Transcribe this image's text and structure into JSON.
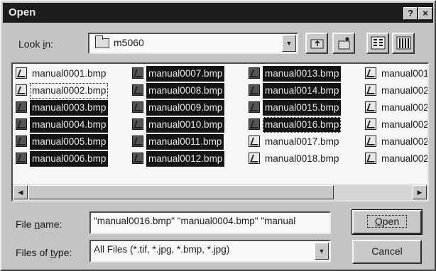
{
  "window": {
    "title": "Open",
    "help_glyph": "?",
    "close_glyph": "×"
  },
  "lookin": {
    "label_prefix": "Look ",
    "label_ul": "i",
    "label_suffix": "n:",
    "value": "m5060"
  },
  "toolbar": {
    "icons": [
      "up-one-level-icon",
      "new-folder-icon",
      "list-view-icon",
      "details-view-icon"
    ]
  },
  "files": {
    "columns": [
      [
        {
          "name": "manual0001.bmp",
          "selected": false
        },
        {
          "name": "manual0002.bmp",
          "selected": false,
          "dotted": true
        },
        {
          "name": "manual0003.bmp",
          "selected": true
        },
        {
          "name": "manual0004.bmp",
          "selected": true
        },
        {
          "name": "manual0005.bmp",
          "selected": true
        },
        {
          "name": "manual0006.bmp",
          "selected": true
        }
      ],
      [
        {
          "name": "manual0007.bmp",
          "selected": true
        },
        {
          "name": "manual0008.bmp",
          "selected": true
        },
        {
          "name": "manual0009.bmp",
          "selected": true
        },
        {
          "name": "manual0010.bmp",
          "selected": true
        },
        {
          "name": "manual0011.bmp",
          "selected": true
        },
        {
          "name": "manual0012.bmp",
          "selected": true
        }
      ],
      [
        {
          "name": "manual0013.bmp",
          "selected": true
        },
        {
          "name": "manual0014.bmp",
          "selected": true
        },
        {
          "name": "manual0015.bmp",
          "selected": true
        },
        {
          "name": "manual0016.bmp",
          "selected": true,
          "focused": true
        },
        {
          "name": "manual0017.bmp",
          "selected": false
        },
        {
          "name": "manual0018.bmp",
          "selected": false
        }
      ],
      [
        {
          "name": "manual001",
          "selected": false
        },
        {
          "name": "manual002",
          "selected": false
        },
        {
          "name": "manual002",
          "selected": false
        },
        {
          "name": "manual002",
          "selected": false
        },
        {
          "name": "manual002",
          "selected": false
        },
        {
          "name": "manual002",
          "selected": false
        }
      ]
    ]
  },
  "filename": {
    "label_prefix": "File ",
    "label_ul": "n",
    "label_suffix": "ame:",
    "value": "\"manual0016.bmp\" \"manual0004.bmp\" \"manual"
  },
  "filetype": {
    "label_prefix": "Files of ",
    "label_ul": "t",
    "label_suffix": "ype:",
    "value": "All Files (*.tif, *.jpg, *.bmp, *.jpg)"
  },
  "buttons": {
    "open_ul": "O",
    "open_rest": "pen",
    "cancel": "Cancel"
  }
}
